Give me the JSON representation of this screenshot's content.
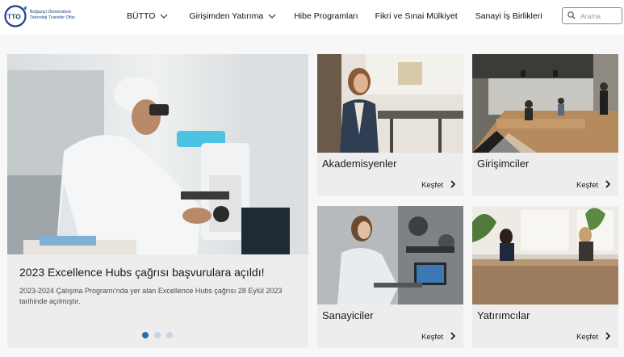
{
  "header": {
    "logo_mark": "TTO",
    "logo_line1": "Boğaziçi Üniversitesi",
    "logo_line2": "Teknoloji Transfer Ofisi",
    "nav": [
      {
        "label": "BÜTTO",
        "has_dropdown": true
      },
      {
        "label": "Girişimden Yatırıma",
        "has_dropdown": true
      },
      {
        "label": "Hibe Programları",
        "has_dropdown": false
      },
      {
        "label": "Fikri ve Sınai Mülkiyet",
        "has_dropdown": false
      },
      {
        "label": "Sanayi İş Birlikleri",
        "has_dropdown": false
      }
    ],
    "search_placeholder": "Arama",
    "search_icon": "search-icon"
  },
  "hero": {
    "title": "2023 Excellence Hubs çağrısı başvurulara açıldı!",
    "description": "2023-2024 Çalışma Programı'nda yer alan Excellence Hubs çağrısı 28 Eylül 2023 tarihinde açılmıştır.",
    "image": "scientist-microscope-photo",
    "slide_count": 3,
    "active_slide": 1
  },
  "cards": [
    {
      "title": "Akademisyenler",
      "link": "Keşfet",
      "image": "academic-woman-photo"
    },
    {
      "title": "Girişimciler",
      "link": "Keşfet",
      "image": "office-workspace-photo"
    },
    {
      "title": "Sanayiciler",
      "link": "Keşfet",
      "image": "lab-engineer-photo"
    },
    {
      "title": "Yatırımcılar",
      "link": "Keşfet",
      "image": "meeting-room-photo"
    }
  ],
  "colors": {
    "brand_blue": "#1d3f8a",
    "dot_active": "#2d6bb0",
    "dot_inactive": "#c6d5e6",
    "card_bg": "#ededed"
  }
}
